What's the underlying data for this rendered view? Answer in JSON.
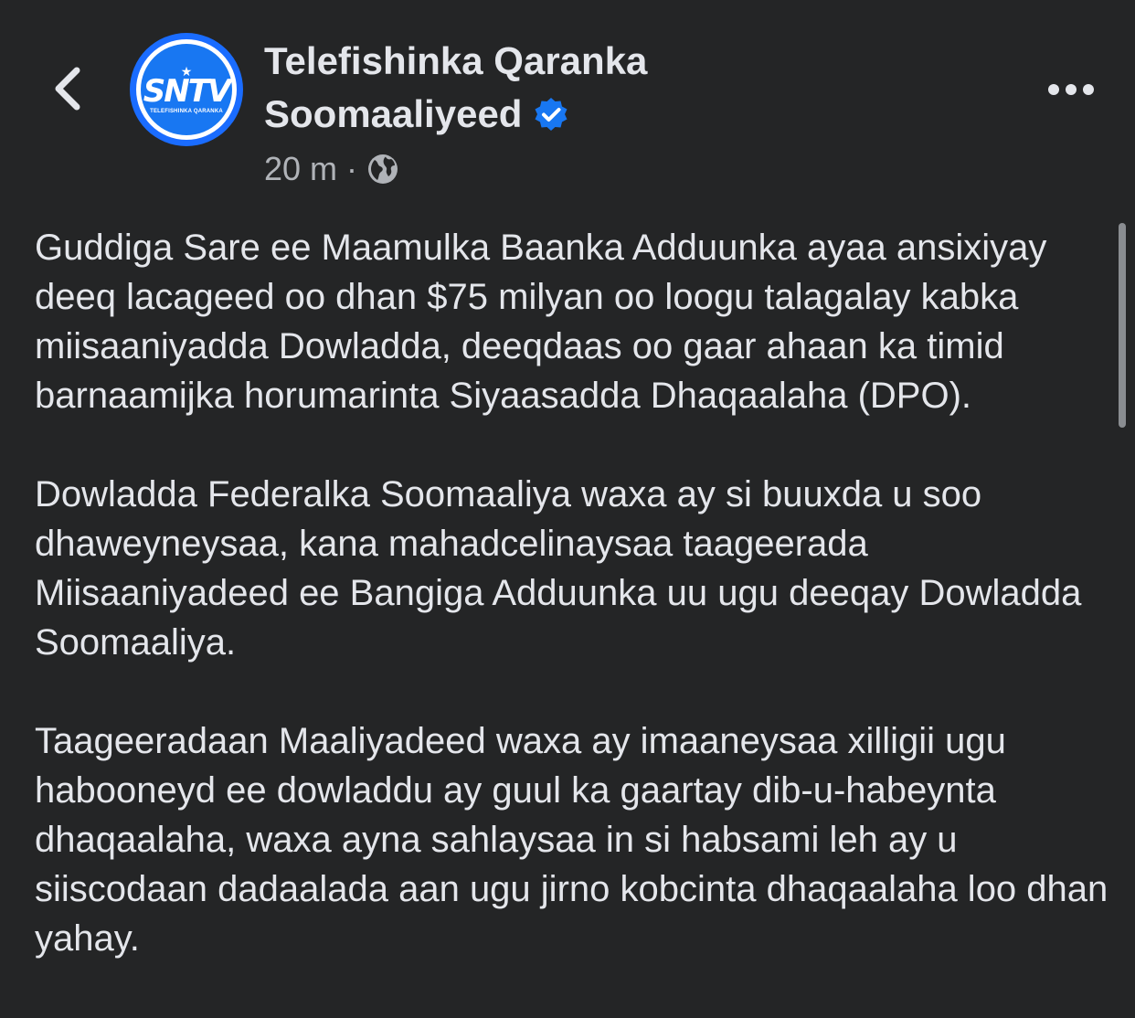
{
  "header": {
    "back_icon": "chevron-left-icon",
    "page_name_line1": "Telefishinka Qaranka",
    "page_name_line2": "Soomaaliyeed",
    "verified_icon": "verified-badge-icon",
    "timestamp": "20 m",
    "separator": "·",
    "privacy_icon": "globe-icon",
    "more_icon": "more-options-icon"
  },
  "avatar": {
    "logo_text": "SNTV",
    "logo_subtext": "TELEFISHINKA QARANKA",
    "accent_color": "#1877f2"
  },
  "post": {
    "paragraphs": [
      "Guddiga Sare ee Maamulka Baanka Adduunka ayaa ansixiyay deeq lacageed oo dhan $75 milyan oo loogu talagalay kabka miisaaniyadda Dowladda, deeqdaas oo gaar ahaan ka timid barnaamijka horumarinta Siyaasadda Dhaqaalaha (DPO).",
      "Dowladda Federalka Soomaaliya waxa ay si buuxda u soo dhaweyneysaa, kana mahadcelinaysaa taageerada Miisaaniyadeed ee Bangiga Adduunka uu ugu deeqay Dowladda Soomaaliya.",
      "Taageeradaan Maaliyadeed waxa ay imaaneysaa xilligii ugu habooneyd  ee dowladdu ay guul ka gaartay dib-u-habeynta dhaqaalaha, waxa ayna sahlaysaa in si habsami leh ay u siiscodaan dadaalada aan ugu jirno kobcinta dhaqaalaha loo dhan yahay."
    ]
  },
  "colors": {
    "background": "#242526",
    "text_primary": "#e4e6eb",
    "text_secondary": "#b0b3b8",
    "verified_blue": "#1877f2"
  }
}
